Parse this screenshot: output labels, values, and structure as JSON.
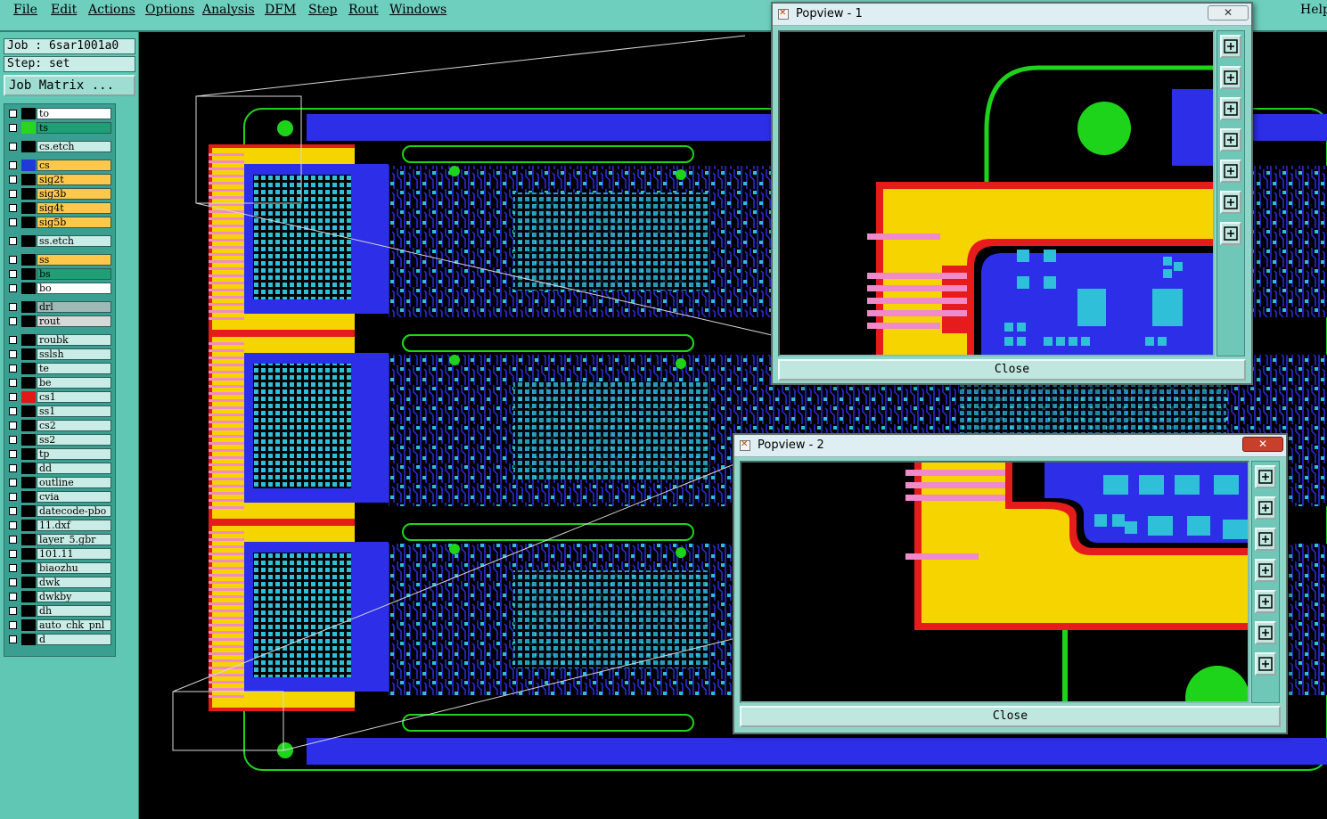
{
  "menu": [
    "File",
    "Edit",
    "Actions",
    "Options",
    "Analysis",
    "DFM",
    "Step",
    "Rout",
    "Windows"
  ],
  "help_label": "Help",
  "job_line": "Job : 6sar1001a0",
  "step_line": "Step: set",
  "job_matrix_label": "Job Matrix ...",
  "layers": [
    {
      "name": "to",
      "bg": "#ffffff",
      "swatch": ""
    },
    {
      "name": "ts",
      "bg": "#1f9f74",
      "swatch": "#27d61d"
    },
    {
      "name": "cs.etch",
      "bg": "#c9ece6",
      "swatch": ""
    },
    {
      "name": "cs",
      "bg": "#ffc84a",
      "swatch": "#1f3ad8"
    },
    {
      "name": "sig2t",
      "bg": "#ffc84a",
      "swatch": ""
    },
    {
      "name": "sig3b",
      "bg": "#ffc84a",
      "swatch": ""
    },
    {
      "name": "sig4t",
      "bg": "#ffc84a",
      "swatch": ""
    },
    {
      "name": "sig5b",
      "bg": "#ffc84a",
      "swatch": ""
    },
    {
      "name": "ss.etch",
      "bg": "#c9ece6",
      "swatch": ""
    },
    {
      "name": "ss",
      "bg": "#ffc84a",
      "swatch": ""
    },
    {
      "name": "bs",
      "bg": "#1f9f74",
      "swatch": ""
    },
    {
      "name": "bo",
      "bg": "#ffffff",
      "swatch": ""
    },
    {
      "name": "drl",
      "bg": "#9fb9b6",
      "swatch": ""
    },
    {
      "name": "rout",
      "bg": "#d8d8d8",
      "swatch": ""
    },
    {
      "name": "roubk",
      "bg": "#c9ece6",
      "swatch": ""
    },
    {
      "name": "sslsh",
      "bg": "#c9ece6",
      "swatch": ""
    },
    {
      "name": "te",
      "bg": "#c9ece6",
      "swatch": ""
    },
    {
      "name": "be",
      "bg": "#c9ece6",
      "swatch": ""
    },
    {
      "name": "cs1",
      "bg": "#c9ece6",
      "swatch": "#e01818"
    },
    {
      "name": "ss1",
      "bg": "#c9ece6",
      "swatch": ""
    },
    {
      "name": "cs2",
      "bg": "#c9ece6",
      "swatch": ""
    },
    {
      "name": "ss2",
      "bg": "#c9ece6",
      "swatch": ""
    },
    {
      "name": "tp",
      "bg": "#c9ece6",
      "swatch": ""
    },
    {
      "name": "dd",
      "bg": "#c9ece6",
      "swatch": ""
    },
    {
      "name": "outline",
      "bg": "#c9ece6",
      "swatch": ""
    },
    {
      "name": "cvia",
      "bg": "#c9ece6",
      "swatch": ""
    },
    {
      "name": "datecode-pbo",
      "bg": "#c9ece6",
      "swatch": ""
    },
    {
      "name": "11.dxf",
      "bg": "#c9ece6",
      "swatch": ""
    },
    {
      "name": "layer_5.gbr",
      "bg": "#c9ece6",
      "swatch": ""
    },
    {
      "name": "101.11",
      "bg": "#c9ece6",
      "swatch": ""
    },
    {
      "name": "biaozhu",
      "bg": "#c9ece6",
      "swatch": ""
    },
    {
      "name": "dwk",
      "bg": "#c9ece6",
      "swatch": ""
    },
    {
      "name": "dwkby",
      "bg": "#c9ece6",
      "swatch": ""
    },
    {
      "name": "dh",
      "bg": "#c9ece6",
      "swatch": ""
    },
    {
      "name": "auto_chk_pnl",
      "bg": "#c9ece6",
      "swatch": ""
    },
    {
      "name": "d",
      "bg": "#c9ece6",
      "swatch": ""
    }
  ],
  "popup1": {
    "title": "Popview - 1",
    "close_label": "Close"
  },
  "popup2": {
    "title": "Popview - 2",
    "close_label": "Close"
  },
  "colors": {
    "copper": "#2d2ee8",
    "pad": "#2fbfd8",
    "mask": "#1ed41a",
    "silk": "#f5d400",
    "outline": "#e61b1b"
  }
}
